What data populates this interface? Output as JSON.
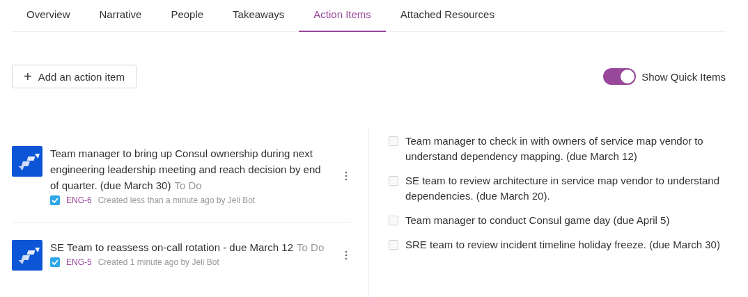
{
  "tabs": [
    {
      "label": "Overview",
      "selected": false
    },
    {
      "label": "Narrative",
      "selected": false
    },
    {
      "label": "People",
      "selected": false
    },
    {
      "label": "Takeaways",
      "selected": false
    },
    {
      "label": "Action Items",
      "selected": true
    },
    {
      "label": "Attached Resources",
      "selected": false
    }
  ],
  "add_button": {
    "icon": "+",
    "label": "Add an action item"
  },
  "quick_items_toggle": {
    "label": "Show Quick Items",
    "on": true
  },
  "action_items": [
    {
      "title": "Team manager to bring up Consul ownership during next engineering leadership meeting and reach decision by end of quarter. (due March 30)",
      "status": "To Do",
      "checked": true,
      "key": "ENG-6",
      "created": "Created less than a minute ago by Jeli Bot"
    },
    {
      "title": "SE Team to reassess on-call rotation - due March 12",
      "status": "To Do",
      "checked": true,
      "key": "ENG-5",
      "created": "Created 1 minute ago by Jeli Bot"
    }
  ],
  "quick_items": [
    {
      "text": "Team manager to check in with owners of service map vendor to understand dependency mapping. (due March 12)",
      "checked": false
    },
    {
      "text": "SE team to review architecture in service map vendor to understand dependencies. (due March 20).",
      "checked": false
    },
    {
      "text": "Team manager to conduct Consul game day (due April 5)",
      "checked": false
    },
    {
      "text": "SRE team to review incident timeline holiday freeze. (due March 30)",
      "checked": false
    }
  ]
}
